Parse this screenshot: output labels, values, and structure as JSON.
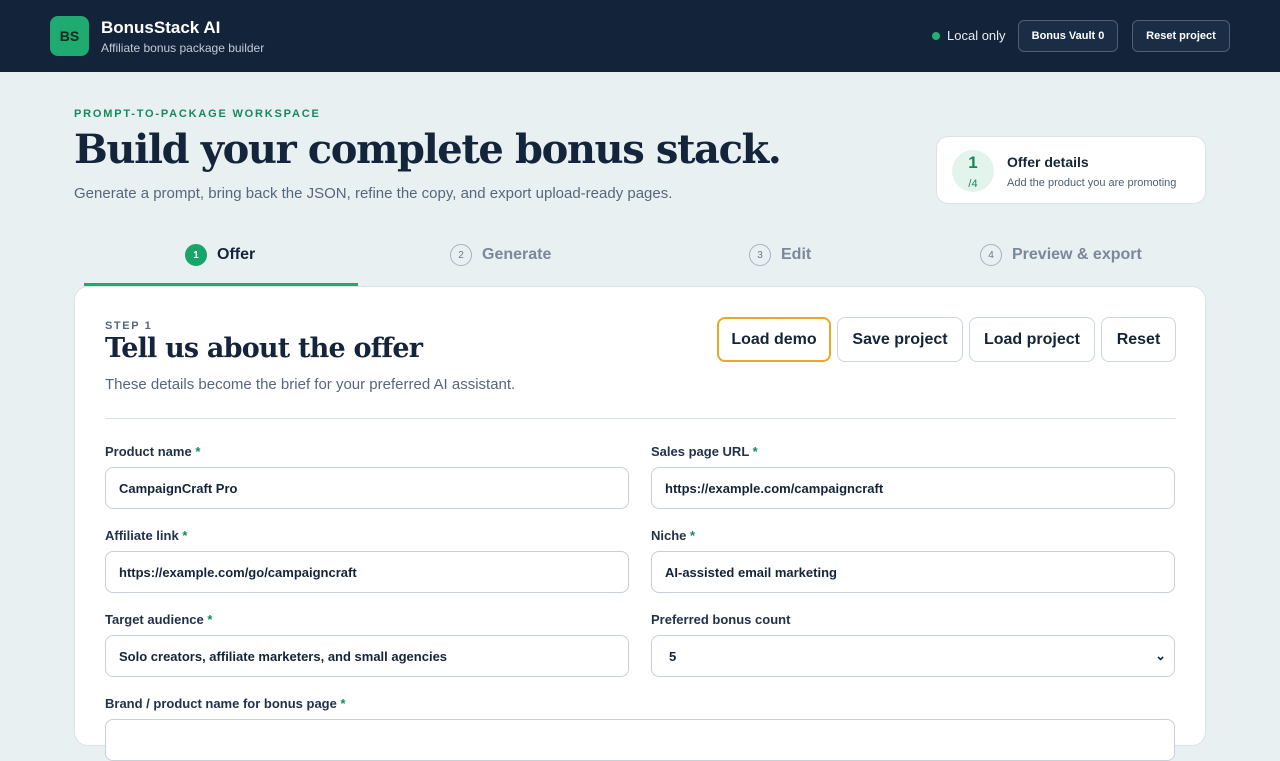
{
  "header": {
    "logo_text": "BS",
    "app_name": "BonusStack AI",
    "tagline": "Affiliate bonus package builder",
    "status_text": "Local only",
    "vault_button": "Bonus Vault 0",
    "reset_project_button": "Reset project",
    "status_color": "#20b073"
  },
  "hero": {
    "eyebrow": "PROMPT-TO-PACKAGE WORKSPACE",
    "title": "Build your complete bonus stack.",
    "subtitle": "Generate a prompt, bring back the JSON, refine the copy, and export upload-ready pages."
  },
  "step_card": {
    "current": "1",
    "total": "/4",
    "title": "Offer details",
    "description": "Add the product you are promoting"
  },
  "tabs": [
    {
      "num": "1",
      "label": "Offer",
      "active": true
    },
    {
      "num": "2",
      "label": "Generate",
      "active": false
    },
    {
      "num": "3",
      "label": "Edit",
      "active": false
    },
    {
      "num": "4",
      "label": "Preview & export",
      "active": false
    }
  ],
  "form": {
    "step_label": "STEP 1",
    "title": "Tell us about the offer",
    "description": "These details become the brief for your preferred AI assistant.",
    "actions": {
      "load_demo": "Load demo",
      "save_project": "Save project",
      "load_project": "Load project",
      "reset": "Reset"
    },
    "fields": {
      "product_name": {
        "label": "Product name",
        "required": "*",
        "value": "CampaignCraft Pro"
      },
      "sales_url": {
        "label": "Sales page URL",
        "required": "*",
        "value": "https://example.com/campaigncraft"
      },
      "affiliate_link": {
        "label": "Affiliate link",
        "required": "*",
        "value": "https://example.com/go/campaigncraft"
      },
      "niche": {
        "label": "Niche",
        "required": "*",
        "value": "AI-assisted email marketing"
      },
      "target_audience": {
        "label": "Target audience",
        "required": "*",
        "value": "Solo creators, affiliate marketers, and small agencies"
      },
      "bonus_count": {
        "label": "Preferred bonus count",
        "value": "5"
      },
      "brand_name": {
        "label": "Brand / product name for bonus page",
        "required": "*"
      }
    }
  },
  "colors": {
    "accent": "#1faa6f",
    "navy": "#12233a",
    "demo_border": "#e5a92a"
  }
}
